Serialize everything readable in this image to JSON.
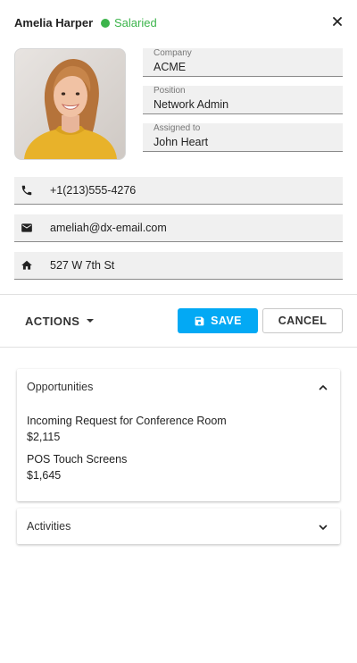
{
  "header": {
    "name": "Amelia Harper",
    "status": "Salaried",
    "status_color": "#3cb44b"
  },
  "details": {
    "company_label": "Company",
    "company": "ACME",
    "position_label": "Position",
    "position": "Network Admin",
    "assigned_label": "Assigned to",
    "assigned": "John Heart"
  },
  "contact": {
    "phone": "+1(213)555-4276",
    "email": "ameliah@dx-email.com",
    "address": "527 W 7th St"
  },
  "toolbar": {
    "actions_label": "ACTIONS",
    "save_label": "SAVE",
    "cancel_label": "CANCEL",
    "accent": "#03a9f4"
  },
  "opportunities": {
    "title": "Opportunities",
    "items": [
      {
        "name": "Incoming Request for Conference Room",
        "amount": "$2,115"
      },
      {
        "name": "POS Touch Screens",
        "amount": "$1,645"
      }
    ]
  },
  "activities": {
    "title": "Activities"
  }
}
